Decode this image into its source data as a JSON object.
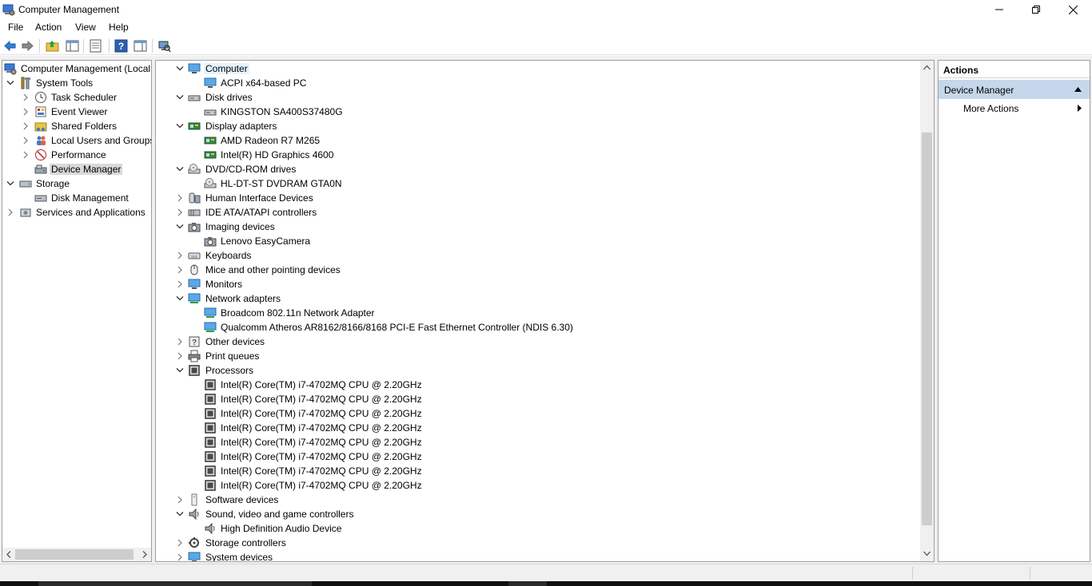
{
  "window": {
    "title": "Computer Management",
    "controls": {
      "minimize": "—",
      "restore": "❐",
      "close": "✕"
    }
  },
  "menu": [
    "File",
    "Action",
    "View",
    "Help"
  ],
  "toolbar_icons": [
    "back-arrow-icon",
    "forward-arrow-icon",
    "up-folder-icon",
    "show-hide-tree-icon",
    "properties-icon",
    "help-icon",
    "show-hide-action-pane-icon",
    "scan-hardware-icon"
  ],
  "left_tree": [
    {
      "label": "Computer Management (Local",
      "icon": "computer-management-icon",
      "level": 0,
      "chev": "none"
    },
    {
      "label": "System Tools",
      "icon": "system-tools-icon",
      "level": 1,
      "chev": "down"
    },
    {
      "label": "Task Scheduler",
      "icon": "clock-icon",
      "level": 2,
      "chev": "right"
    },
    {
      "label": "Event Viewer",
      "icon": "event-viewer-icon",
      "level": 2,
      "chev": "right"
    },
    {
      "label": "Shared Folders",
      "icon": "shared-folder-icon",
      "level": 2,
      "chev": "right"
    },
    {
      "label": "Local Users and Groups",
      "icon": "users-icon",
      "level": 2,
      "chev": "right"
    },
    {
      "label": "Performance",
      "icon": "performance-icon",
      "level": 2,
      "chev": "right"
    },
    {
      "label": "Device Manager",
      "icon": "device-manager-icon",
      "level": 2,
      "chev": "none",
      "selected": true
    },
    {
      "label": "Storage",
      "icon": "storage-icon",
      "level": 1,
      "chev": "down"
    },
    {
      "label": "Disk Management",
      "icon": "disk-management-icon",
      "level": 2,
      "chev": "none"
    },
    {
      "label": "Services and Applications",
      "icon": "services-icon",
      "level": 1,
      "chev": "right"
    }
  ],
  "device_tree": [
    {
      "label": "Computer",
      "icon": "monitor-icon",
      "level": 0,
      "chev": "down",
      "selected": true
    },
    {
      "label": "ACPI x64-based PC",
      "icon": "monitor-icon",
      "level": 1
    },
    {
      "label": "Disk drives",
      "icon": "disk-drive-icon",
      "level": 0,
      "chev": "down"
    },
    {
      "label": "KINGSTON SA400S37480G",
      "icon": "disk-drive-icon",
      "level": 1
    },
    {
      "label": "Display adapters",
      "icon": "display-adapter-icon",
      "level": 0,
      "chev": "down"
    },
    {
      "label": "AMD Radeon R7 M265",
      "icon": "display-adapter-icon",
      "level": 1
    },
    {
      "label": "Intel(R) HD Graphics 4600",
      "icon": "display-adapter-icon",
      "level": 1
    },
    {
      "label": "DVD/CD-ROM drives",
      "icon": "dvd-drive-icon",
      "level": 0,
      "chev": "down"
    },
    {
      "label": "HL-DT-ST DVDRAM GTA0N",
      "icon": "dvd-drive-icon",
      "level": 1
    },
    {
      "label": "Human Interface Devices",
      "icon": "hid-icon",
      "level": 0,
      "chev": "right"
    },
    {
      "label": "IDE ATA/ATAPI controllers",
      "icon": "ide-controller-icon",
      "level": 0,
      "chev": "right"
    },
    {
      "label": "Imaging devices",
      "icon": "camera-icon",
      "level": 0,
      "chev": "down"
    },
    {
      "label": "Lenovo EasyCamera",
      "icon": "camera-icon",
      "level": 1
    },
    {
      "label": "Keyboards",
      "icon": "keyboard-icon",
      "level": 0,
      "chev": "right"
    },
    {
      "label": "Mice and other pointing devices",
      "icon": "mouse-icon",
      "level": 0,
      "chev": "right"
    },
    {
      "label": "Monitors",
      "icon": "monitor-icon",
      "level": 0,
      "chev": "right"
    },
    {
      "label": "Network adapters",
      "icon": "network-adapter-icon",
      "level": 0,
      "chev": "down"
    },
    {
      "label": "Broadcom 802.11n Network Adapter",
      "icon": "network-adapter-icon",
      "level": 1
    },
    {
      "label": "Qualcomm Atheros AR8162/8166/8168 PCI-E Fast Ethernet Controller (NDIS 6.30)",
      "icon": "network-adapter-icon",
      "level": 1
    },
    {
      "label": "Other devices",
      "icon": "unknown-device-icon",
      "level": 0,
      "chev": "right"
    },
    {
      "label": "Print queues",
      "icon": "printer-icon",
      "level": 0,
      "chev": "right"
    },
    {
      "label": "Processors",
      "icon": "processor-icon",
      "level": 0,
      "chev": "down"
    },
    {
      "label": "Intel(R) Core(TM) i7-4702MQ CPU @ 2.20GHz",
      "icon": "processor-icon",
      "level": 1
    },
    {
      "label": "Intel(R) Core(TM) i7-4702MQ CPU @ 2.20GHz",
      "icon": "processor-icon",
      "level": 1
    },
    {
      "label": "Intel(R) Core(TM) i7-4702MQ CPU @ 2.20GHz",
      "icon": "processor-icon",
      "level": 1
    },
    {
      "label": "Intel(R) Core(TM) i7-4702MQ CPU @ 2.20GHz",
      "icon": "processor-icon",
      "level": 1
    },
    {
      "label": "Intel(R) Core(TM) i7-4702MQ CPU @ 2.20GHz",
      "icon": "processor-icon",
      "level": 1
    },
    {
      "label": "Intel(R) Core(TM) i7-4702MQ CPU @ 2.20GHz",
      "icon": "processor-icon",
      "level": 1
    },
    {
      "label": "Intel(R) Core(TM) i7-4702MQ CPU @ 2.20GHz",
      "icon": "processor-icon",
      "level": 1
    },
    {
      "label": "Intel(R) Core(TM) i7-4702MQ CPU @ 2.20GHz",
      "icon": "processor-icon",
      "level": 1
    },
    {
      "label": "Software devices",
      "icon": "software-device-icon",
      "level": 0,
      "chev": "right"
    },
    {
      "label": "Sound, video and game controllers",
      "icon": "speaker-icon",
      "level": 0,
      "chev": "down"
    },
    {
      "label": "High Definition Audio Device",
      "icon": "speaker-icon",
      "level": 1
    },
    {
      "label": "Storage controllers",
      "icon": "storage-controller-icon",
      "level": 0,
      "chev": "right"
    },
    {
      "label": "System devices",
      "icon": "monitor-icon",
      "level": 0,
      "chev": "right"
    }
  ],
  "actions": {
    "header": "Actions",
    "section": "Device Manager",
    "items": [
      "More Actions"
    ]
  },
  "colors": {
    "selection_left": "#d9d9d9",
    "selection_center": "#e5f3ff",
    "actions_section": "#c5d7ea",
    "pane_border": "#a0a0a0",
    "frame": "#f0f0f0"
  }
}
